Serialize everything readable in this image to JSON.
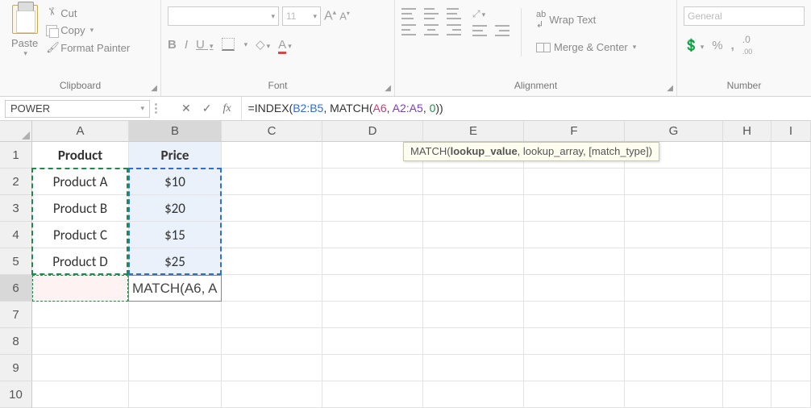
{
  "ribbon": {
    "clipboard": {
      "paste": "Paste",
      "cut": "Cut",
      "copy": "Copy",
      "format_painter": "Format Painter",
      "label": "Clipboard"
    },
    "font": {
      "size": "11",
      "bold": "B",
      "italic": "I",
      "underline": "U",
      "label": "Font"
    },
    "alignment": {
      "wrap": "Wrap Text",
      "merge": "Merge & Center",
      "label": "Alignment"
    },
    "number": {
      "format": "General",
      "percent": "%",
      "comma": ",",
      "label": "Number"
    }
  },
  "formula_bar": {
    "name_box": "POWER",
    "formula_prefix": "=INDEX(",
    "range1": "B2:B5",
    "sep1": ", MATCH(",
    "arg1": "A6",
    "sep2": ", ",
    "arg2": "A2:A5",
    "sep3": ", ",
    "num": "0",
    "suffix": "))"
  },
  "tooltip": {
    "func": "MATCH(",
    "p1": "lookup_value",
    "p2": ", lookup_array, [match_type])"
  },
  "columns": [
    "A",
    "B",
    "C",
    "D",
    "E",
    "F",
    "G",
    "H",
    "I"
  ],
  "rows": [
    "1",
    "2",
    "3",
    "4",
    "5",
    "6",
    "7",
    "8",
    "9",
    "10"
  ],
  "data": {
    "A1": "Product",
    "B1": "Price",
    "A2": "Product A",
    "B2": "$10",
    "A3": "Product B",
    "B3": "$20",
    "A4": "Product C",
    "B4": "$15",
    "A5": "Product D",
    "B5": "$25",
    "B6_display": "MATCH(A6, A"
  },
  "chart_data": {
    "type": "table",
    "title": "",
    "columns": [
      "Product",
      "Price"
    ],
    "rows": [
      [
        "Product A",
        10
      ],
      [
        "Product B",
        20
      ],
      [
        "Product C",
        15
      ],
      [
        "Product D",
        25
      ]
    ],
    "formula_cell": "B6",
    "formula": "=INDEX(B2:B5, MATCH(A6, A2:A5, 0))"
  }
}
